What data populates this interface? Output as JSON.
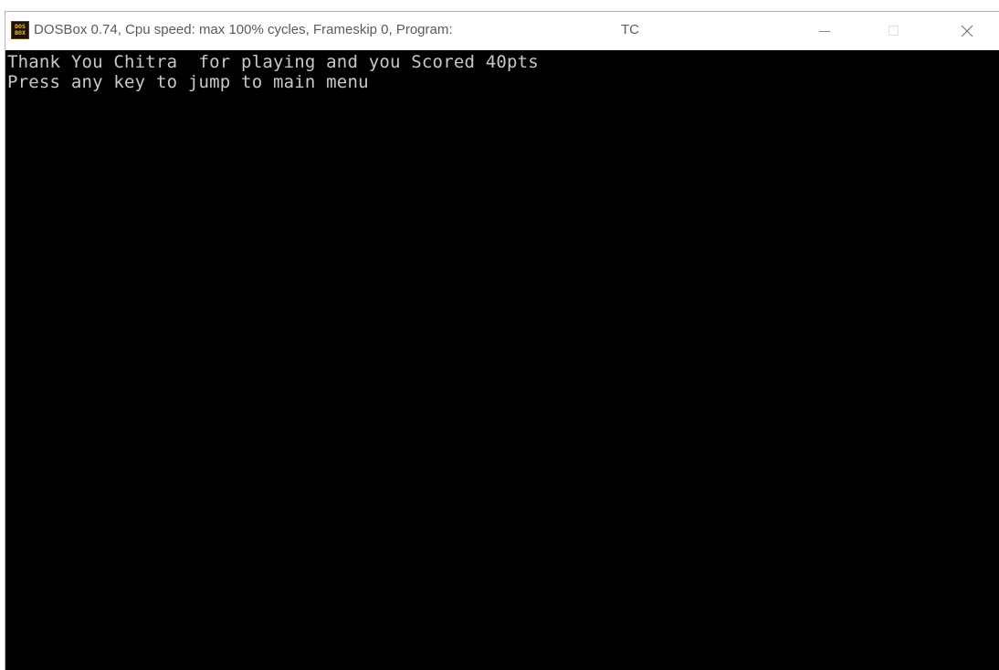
{
  "window": {
    "title": "DOSBox 0.74, Cpu speed: max 100% cycles, Frameskip  0, Program:",
    "program": "TC",
    "icon": {
      "name": "dosbox-icon",
      "line1": "DOS",
      "line2": "BOX"
    },
    "controls": {
      "minimize_icon": "minimize-icon",
      "maximize_icon": "maximize-icon",
      "close_icon": "close-icon"
    }
  },
  "console": {
    "lines": [
      "Thank You Chitra  for playing and you Scored 40pts",
      "Press any key to jump to main menu"
    ]
  },
  "colors": {
    "console_background": "#000000",
    "console_text": "#c8c8c8",
    "titlebar_background": "#ffffff",
    "titlebar_text": "#5a5a5a"
  }
}
